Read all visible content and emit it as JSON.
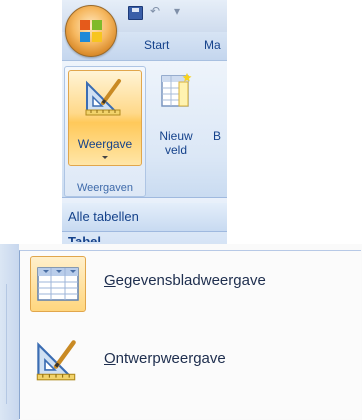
{
  "ribbon": {
    "tabs": [
      "Start",
      "Ma"
    ],
    "quick_access": {
      "undo_glyph": "↶",
      "more_glyph": "▾"
    },
    "views_group": {
      "button_label": "Weergave",
      "group_label": "Weergaven"
    },
    "new_field": {
      "line1": "Nieuw",
      "line2": "veld"
    },
    "next_button_partial": "B"
  },
  "nav_pane": {
    "title": "Alle tabellen",
    "next_item_partial": "Tabel"
  },
  "view_menu": {
    "items": [
      {
        "accel": "G",
        "rest": "egevensbladweergave",
        "icon": "datasheet-icon"
      },
      {
        "accel": "O",
        "rest": "ntwerpweergave",
        "icon": "design-view-icon"
      }
    ]
  },
  "colors": {
    "ribbon_text": "#15428b",
    "hover_border": "#e1a64c",
    "hover_fill": "#ffd67e"
  }
}
